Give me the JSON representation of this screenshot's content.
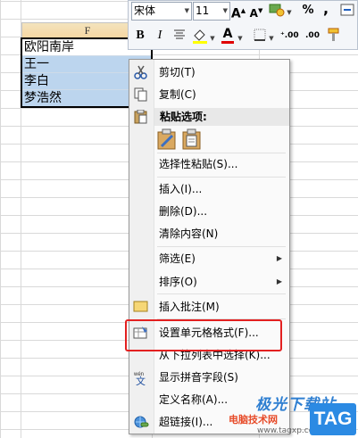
{
  "spreadsheet": {
    "column_label": "F",
    "cells": [
      "欧阳南岸",
      "王一",
      "李白",
      "梦浩然"
    ]
  },
  "mini_toolbar": {
    "font_name": "宋体",
    "font_size": "11",
    "percent_symbol": "%",
    "comma_symbol": ",",
    "bold": "B",
    "italic": "I",
    "font_color_letter": "A",
    "increase_font": "A",
    "decrease_font": "A"
  },
  "context_menu": {
    "items": [
      {
        "label": "剪切(T)",
        "icon": "scissors-icon"
      },
      {
        "label": "复制(C)",
        "icon": "copy-icon"
      },
      {
        "label": "粘贴选项:",
        "icon": "paste-icon"
      },
      {
        "label": "选择性粘贴(S)...",
        "icon": ""
      },
      {
        "label": "插入(I)...",
        "icon": ""
      },
      {
        "label": "删除(D)...",
        "icon": ""
      },
      {
        "label": "清除内容(N)",
        "icon": ""
      },
      {
        "label": "筛选(E)",
        "icon": "",
        "submenu": true
      },
      {
        "label": "排序(O)",
        "icon": "",
        "submenu": true
      },
      {
        "label": "插入批注(M)",
        "icon": "comment-icon"
      },
      {
        "label": "设置单元格格式(F)...",
        "icon": "format-cells-icon"
      },
      {
        "label": "从下拉列表中选择(K)...",
        "icon": ""
      },
      {
        "label": "显示拼音字段(S)",
        "icon": "phonetic-icon"
      },
      {
        "label": "定义名称(A)...",
        "icon": ""
      },
      {
        "label": "超链接(I)...",
        "icon": "hyperlink-icon"
      }
    ],
    "submenu_arrow": "▶"
  },
  "watermark": {
    "title": "极光下载站",
    "subtitle": "电脑技术网",
    "url": "www.tagxp.com",
    "tag": "TAG"
  },
  "colors": {
    "selection": "#bcd5ee",
    "highlight": "#e32020",
    "menu_bg": "#fafafa"
  }
}
